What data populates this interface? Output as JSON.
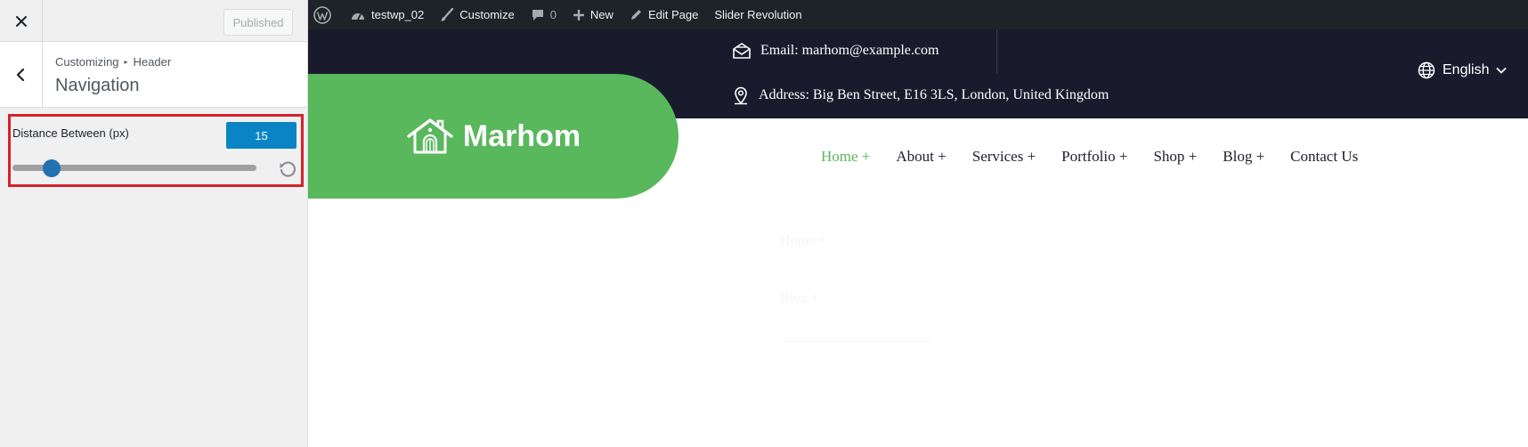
{
  "sidebar": {
    "close_label": "Close",
    "published_label": "Published",
    "breadcrumb": {
      "root": "Customizing",
      "parent": "Header"
    },
    "section_title": "Navigation",
    "control": {
      "label": "Distance Between (px)",
      "value": "15",
      "slider_fraction": 0.15
    }
  },
  "adminbar": {
    "items": {
      "site": "testwp_02",
      "customize": "Customize",
      "comments_count": "0",
      "new": "New",
      "edit_page": "Edit Page",
      "slider": "Slider Revolution"
    }
  },
  "header": {
    "email": "Email: marhom@example.com",
    "address": "Address: Big Ben Street, E16 3LS, London, United Kingdom",
    "language": "English",
    "logo_text": "Marhom"
  },
  "nav": {
    "items": [
      "Home +",
      "About +",
      "Services +",
      "Portfolio +",
      "Shop +",
      "Blog +",
      "Contact Us"
    ],
    "active_index": 0
  },
  "ghost": {
    "line1": "Home +",
    "line2": "Blog +"
  },
  "colors": {
    "accent_green": "#59b75c",
    "topbar_dark": "#191b2d",
    "adminbar": "#1d2327",
    "control_blue": "#0b84c6",
    "highlight_red": "#d6212a"
  },
  "icons": [
    "close-icon",
    "chevron-left-icon",
    "reset-icon",
    "wordpress-icon",
    "dashboard-icon",
    "brush-icon",
    "comment-icon",
    "plus-icon",
    "pencil-icon",
    "email-icon",
    "location-pin-icon",
    "globe-icon",
    "chevron-down-icon",
    "house-icon"
  ]
}
